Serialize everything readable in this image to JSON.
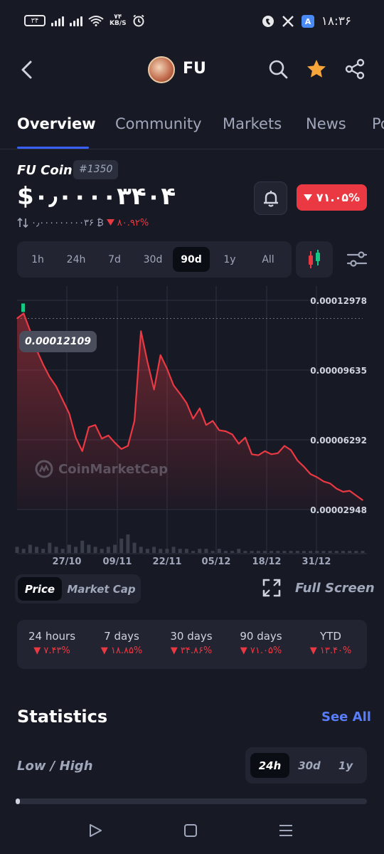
{
  "status_bar": {
    "sim_label": "۳۴",
    "net_speed": "۷۴",
    "net_unit": "KB/S",
    "time": "۱۸:۳۶",
    "icons": [
      "signal-icon",
      "wifi-icon",
      "alarm-icon",
      "messenger-icon",
      "x-icon",
      "translate-icon"
    ]
  },
  "header": {
    "coin_symbol": "FU",
    "icons": [
      "back-icon",
      "search-icon",
      "star-icon",
      "share-icon"
    ],
    "favorite_color": "#f7a63b"
  },
  "tabs": [
    {
      "label": "Overview",
      "active": true
    },
    {
      "label": "Community",
      "active": false
    },
    {
      "label": "Markets",
      "active": false
    },
    {
      "label": "News",
      "active": false
    },
    {
      "label": "Po",
      "active": false
    }
  ],
  "coin": {
    "name": "FU Coin",
    "rank": "#1350",
    "price": "$۰٫۰۰۰۰۳۴۰۴",
    "btc_price": "۰٫۰۰۰۰۰۰۰۰۰۳۶ ₿",
    "btc_change": "۸۰.۹۲%",
    "change_90d": "۷۱.۰۵%",
    "negative_color": "#ea3943"
  },
  "ranges": {
    "options": [
      "1h",
      "24h",
      "7d",
      "30d",
      "90d",
      "1y",
      "All"
    ],
    "selected": "90d"
  },
  "chart_data": {
    "type": "area",
    "title": "",
    "xlabel": "",
    "ylabel": "",
    "x_ticks": [
      "27/10",
      "09/11",
      "22/11",
      "05/12",
      "18/12",
      "31/12"
    ],
    "y_ticks": [
      "0.00012978",
      "0.00009635",
      "0.00006292",
      "0.00002948"
    ],
    "ylim": [
      2.948e-05,
      0.00012978
    ],
    "start_price_label": "0.00012109",
    "series": [
      {
        "values": [
          0.0001211,
          0.0001235,
          0.0001152,
          0.000106,
          9.9e-05,
          9.3e-05,
          8.85e-05,
          8.2e-05,
          7.55e-05,
          6.4e-05,
          5.75e-05,
          6.9e-05,
          7e-05,
          6.35e-05,
          6.5e-05,
          6.15e-05,
          5.85e-05,
          6e-05,
          7.2e-05,
          0.000115,
          0.0001002,
          8.7e-05,
          0.0001035,
          9.7e-05,
          8.9e-05,
          8.5e-05,
          8.05e-05,
          7.3e-05,
          7.8e-05,
          7e-05,
          7.2e-05,
          6.75e-05,
          6.7e-05,
          6.55e-05,
          6.1e-05,
          6.4e-05,
          5.6e-05,
          5.55e-05,
          5.75e-05,
          5.6e-05,
          5.65e-05,
          6e-05,
          5.8e-05,
          5.3e-05,
          5e-05,
          4.65e-05,
          4.5e-05,
          4.3e-05,
          4.2e-05,
          3.95e-05,
          3.8e-05,
          3.85e-05,
          3.62e-05,
          3.4e-05
        ]
      }
    ],
    "volume": [
      3,
      2,
      4,
      3,
      2,
      5,
      3,
      2,
      4,
      3,
      6,
      4,
      3,
      2,
      3,
      4,
      7,
      9,
      5,
      3,
      2,
      3,
      2,
      2,
      3,
      2,
      2,
      1,
      2,
      2,
      1,
      2,
      1,
      1,
      2,
      1,
      1,
      1,
      1,
      1,
      1,
      1,
      1,
      1,
      1,
      1,
      1,
      1,
      1,
      1,
      1,
      1,
      1,
      1
    ],
    "grid": true,
    "line_color": "#ea3943",
    "watermark": "CoinMarketCap"
  },
  "chart_mode": {
    "options": [
      "Price",
      "Market Cap"
    ],
    "selected": "Price",
    "full_screen_label": "Full Screen"
  },
  "performance": [
    {
      "label": "24 hours",
      "value": "۷.۴۳%"
    },
    {
      "label": "7 days",
      "value": "۱۸.۸۵%"
    },
    {
      "label": "30 days",
      "value": "۳۴.۸۶%"
    },
    {
      "label": "90 days",
      "value": "۷۱.۰۵%"
    },
    {
      "label": "YTD",
      "value": "۱۳.۴۰%"
    }
  ],
  "statistics": {
    "title": "Statistics",
    "see_all": "See All",
    "low_high_label": "Low / High",
    "periods": [
      "24h",
      "30d",
      "1y"
    ],
    "selected_period": "24h",
    "low_high_position": 0.0
  },
  "nav_bar": {
    "icons": [
      "back-triangle-icon",
      "home-square-icon",
      "recents-icon"
    ]
  }
}
